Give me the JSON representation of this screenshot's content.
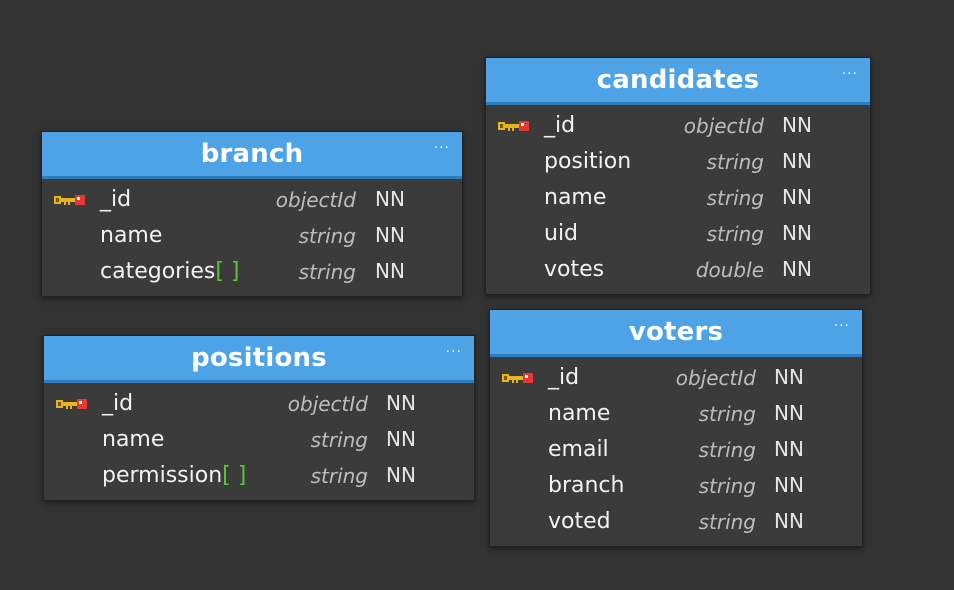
{
  "tables": {
    "branch": {
      "title": "branch",
      "menu": "···",
      "rows": [
        {
          "name": "_id",
          "type": "objectId",
          "nn": "NN"
        },
        {
          "name": "name",
          "type": "string",
          "nn": "NN"
        },
        {
          "name": "categories",
          "brackets": "[ ]",
          "type": "string",
          "nn": "NN"
        }
      ]
    },
    "positions": {
      "title": "positions",
      "menu": "···",
      "rows": [
        {
          "name": "_id",
          "type": "objectId",
          "nn": "NN"
        },
        {
          "name": "name",
          "type": "string",
          "nn": "NN"
        },
        {
          "name": "permission",
          "brackets": "[ ]",
          "type": "string",
          "nn": "NN"
        }
      ]
    },
    "candidates": {
      "title": "candidates",
      "menu": "···",
      "rows": [
        {
          "name": "_id",
          "type": "objectId",
          "nn": "NN"
        },
        {
          "name": "position",
          "type": "string",
          "nn": "NN"
        },
        {
          "name": "name",
          "type": "string",
          "nn": "NN"
        },
        {
          "name": "uid",
          "type": "string",
          "nn": "NN"
        },
        {
          "name": "votes",
          "type": "double",
          "nn": "NN"
        }
      ]
    },
    "voters": {
      "title": "voters",
      "menu": "···",
      "rows": [
        {
          "name": "_id",
          "type": "objectId",
          "nn": "NN"
        },
        {
          "name": "name",
          "type": "string",
          "nn": "NN"
        },
        {
          "name": "email",
          "type": "string",
          "nn": "NN"
        },
        {
          "name": "branch",
          "type": "string",
          "nn": "NN"
        },
        {
          "name": "voted",
          "type": "string",
          "nn": "NN"
        }
      ]
    }
  },
  "icons": {
    "primary_key": "key-icon"
  },
  "colors": {
    "background": "#333333",
    "header": "#4ea2e6",
    "body": "#3b3b3b",
    "array_brackets": "#59c43e",
    "key_gold": "#e6b422",
    "key_red": "#e53935"
  }
}
